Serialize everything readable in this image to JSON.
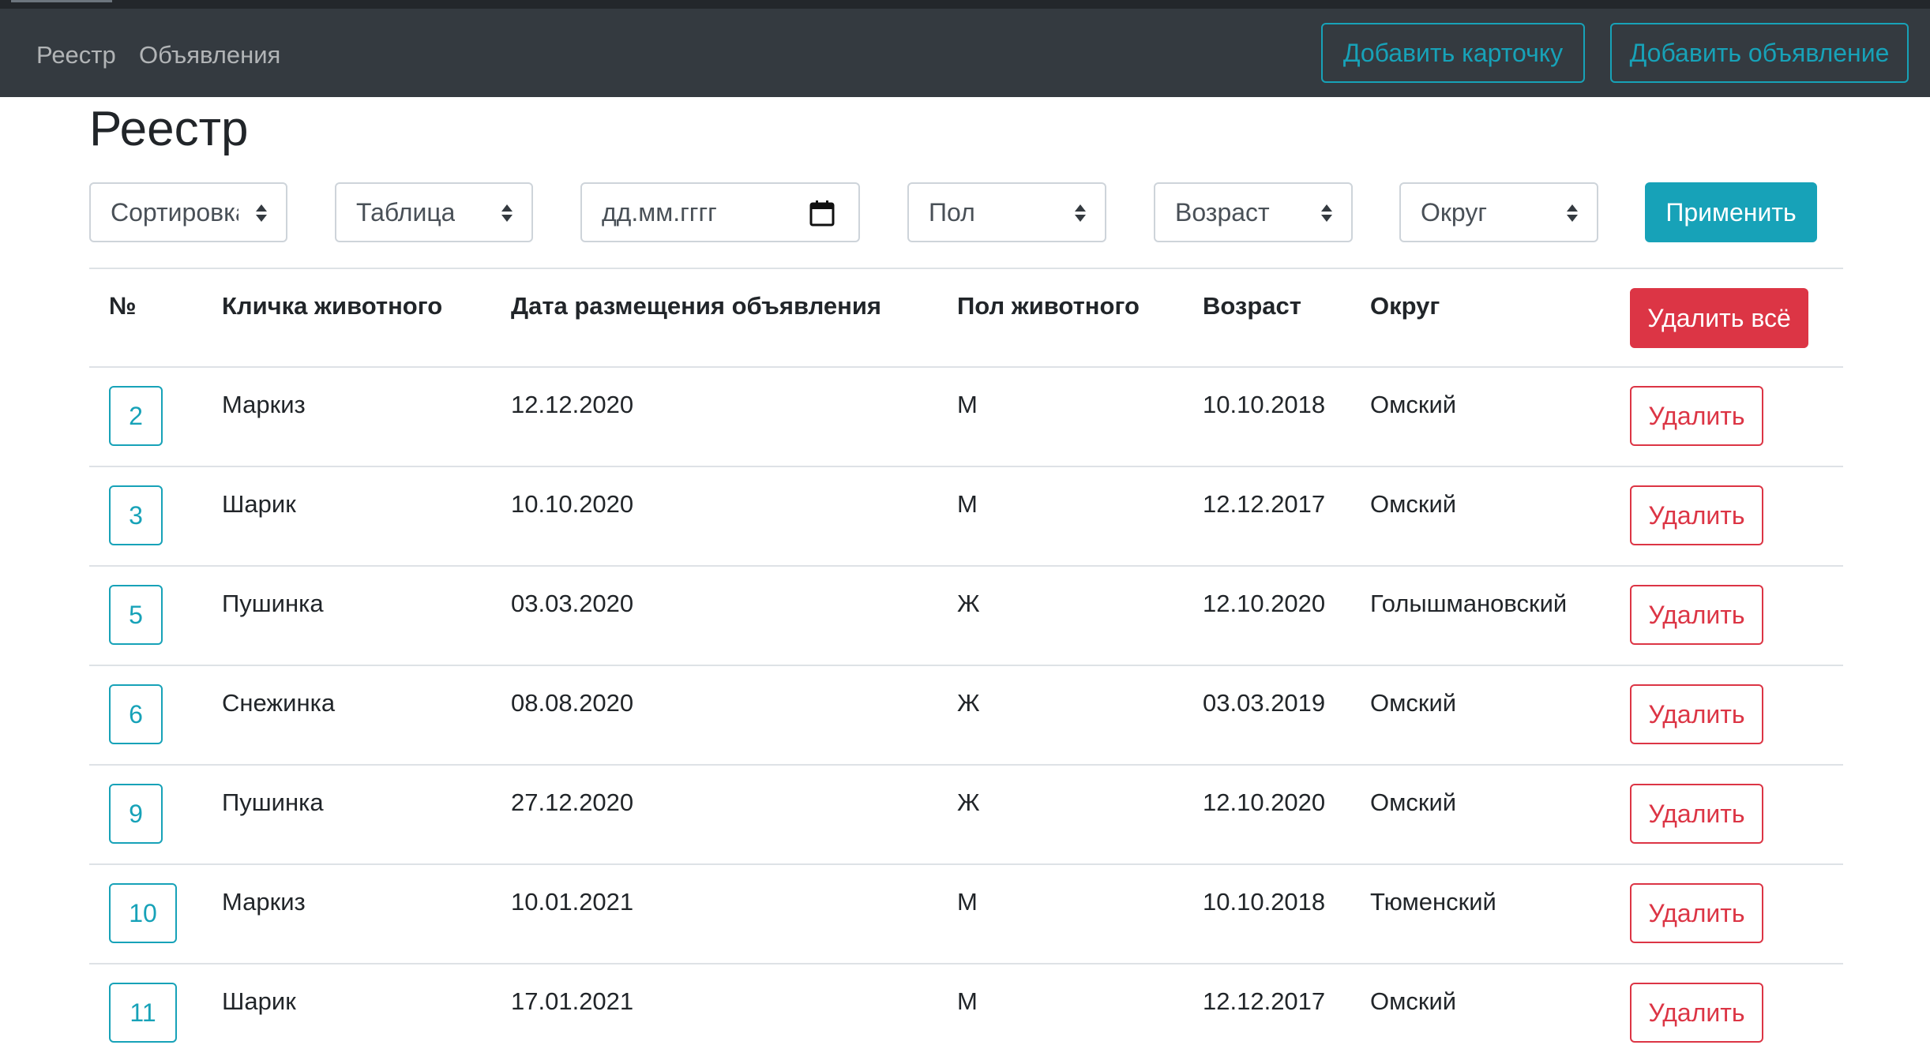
{
  "navbar": {
    "links": [
      "Реестр",
      "Объявления"
    ],
    "add_card_label": "Добавить карточку",
    "add_ad_label": "Добавить объявление"
  },
  "page": {
    "title": "Реестр"
  },
  "filters": {
    "sort": "Сортировка",
    "table": "Таблица",
    "date_placeholder": "дд.мм.гггг",
    "sex": "Пол",
    "age": "Возраст",
    "district": "Округ",
    "apply_label": "Применить"
  },
  "table": {
    "headers": [
      "№",
      "Кличка животного",
      "Дата размещения объявления",
      "Пол животного",
      "Возраст",
      "Округ"
    ],
    "delete_all_label": "Удалить всё",
    "delete_label": "Удалить",
    "rows": [
      {
        "id": "2",
        "name": "Маркиз",
        "date": "12.12.2020",
        "sex": "М",
        "age": "10.10.2018",
        "district": "Омский"
      },
      {
        "id": "3",
        "name": "Шарик",
        "date": "10.10.2020",
        "sex": "М",
        "age": "12.12.2017",
        "district": "Омский"
      },
      {
        "id": "5",
        "name": "Пушинка",
        "date": "03.03.2020",
        "sex": "Ж",
        "age": "12.10.2020",
        "district": "Голышмановский"
      },
      {
        "id": "6",
        "name": "Снежинка",
        "date": "08.08.2020",
        "sex": "Ж",
        "age": "03.03.2019",
        "district": "Омский"
      },
      {
        "id": "9",
        "name": "Пушинка",
        "date": "27.12.2020",
        "sex": "Ж",
        "age": "12.10.2020",
        "district": "Омский"
      },
      {
        "id": "10",
        "name": "Маркиз",
        "date": "10.01.2021",
        "sex": "М",
        "age": "10.10.2018",
        "district": "Тюменский"
      },
      {
        "id": "11",
        "name": "Шарик",
        "date": "17.01.2021",
        "sex": "М",
        "age": "12.12.2017",
        "district": "Омский"
      }
    ]
  },
  "colors": {
    "navbar": "#343a40",
    "info": "#17a2b8",
    "danger": "#dc3545"
  },
  "icons": {
    "calendar": "calendar-icon",
    "select": "select-caret-icon"
  }
}
